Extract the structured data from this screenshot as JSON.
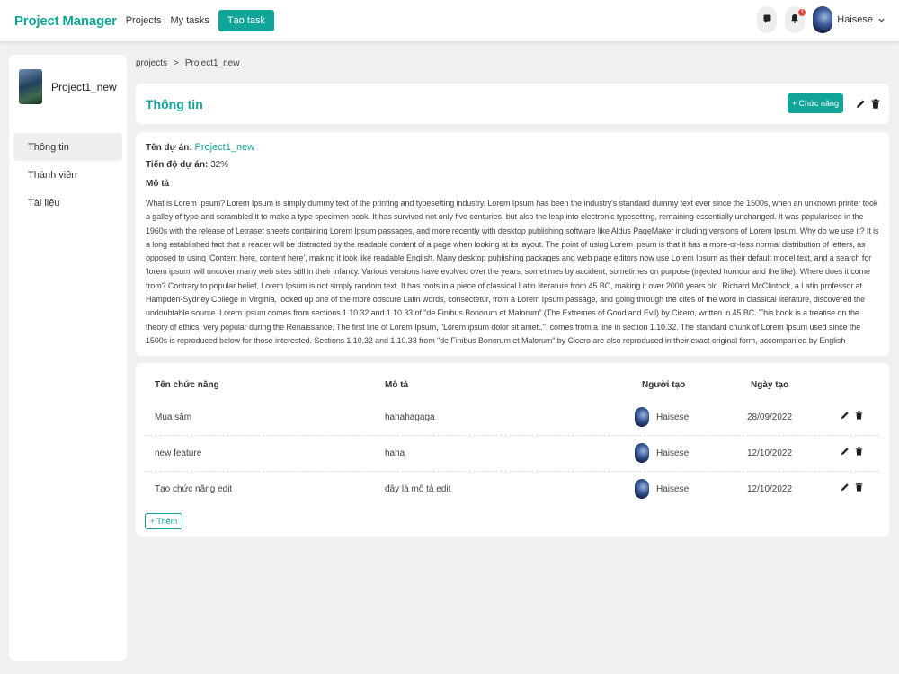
{
  "navbar": {
    "brand": "Project Manager",
    "links": [
      "Projects",
      "My tasks"
    ],
    "cta_label": "Tạo task",
    "notification_count": "1",
    "user_name": "Haisese"
  },
  "sidebar": {
    "project_name": "Project1_new",
    "items": [
      {
        "label": "Thông tin",
        "active": true
      },
      {
        "label": "Thành viên",
        "active": false
      },
      {
        "label": "Tài liệu",
        "active": false
      }
    ]
  },
  "breadcrumb": {
    "root": "projects",
    "sep": ">",
    "current": "Project1_new"
  },
  "header": {
    "title": "Thông tin",
    "add_label": "+ Chức năng"
  },
  "info": {
    "name_label": "Tên dự án:",
    "name_value": "Project1_new",
    "progress_label": "Tiến độ dự án:",
    "progress_value": "32%",
    "desc_label": "Mô tả",
    "desc_text": "What is Lorem Ipsum? Lorem Ipsum is simply dummy text of the printing and typesetting industry. Lorem Ipsum has been the industry's standard dummy text ever since the 1500s, when an unknown printer took a galley of type and scrambled it to make a type specimen book. It has survived not only five centuries, but also the leap into electronic typesetting, remaining essentially unchanged. It was popularised in the 1960s with the release of Letraset sheets containing Lorem Ipsum passages, and more recently with desktop publishing software like Aldus PageMaker including versions of Lorem Ipsum. Why do we use it? It is a long established fact that a reader will be distracted by the readable content of a page when looking at its layout. The point of using Lorem Ipsum is that it has a more-or-less normal distribution of letters, as opposed to using 'Content here, content here', making it look like readable English. Many desktop publishing packages and web page editors now use Lorem Ipsum as their default model text, and a search for 'lorem ipsum' will uncover many web sites still in their infancy. Various versions have evolved over the years, sometimes by accident, sometimes on purpose (injected humour and the like). Where does it come from? Contrary to popular belief, Lorem Ipsum is not simply random text. It has roots in a piece of classical Latin literature from 45 BC, making it over 2000 years old. Richard McClintock, a Latin professor at Hampden-Sydney College in Virginia, looked up one of the more obscure Latin words, consectetur, from a Lorem Ipsum passage, and going through the cites of the word in classical literature, discovered the undoubtable source. Lorem Ipsum comes from sections 1.10.32 and 1.10.33 of \"de Finibus Bonorum et Malorum\" (The Extremes of Good and Evil) by Cicero, written in 45 BC. This book is a treatise on the theory of ethics, very popular during the Renaissance. The first line of Lorem Ipsum, \"Lorem ipsum dolor sit amet..\", comes from a line in section 1.10.32. The standard chunk of Lorem Ipsum used since the 1500s is reproduced below for those interested. Sections 1.10.32 and 1.10.33 from \"de Finibus Bonorum et Malorum\" by Cicero are also reproduced in their exact original form, accompanied by English"
  },
  "table": {
    "headers": [
      "Tên chức năng",
      "Mô tả",
      "Người tạo",
      "Ngày tạo"
    ],
    "rows": [
      {
        "name": "Mua sắm",
        "desc": "hahahagaga",
        "creator": "Haisese",
        "date": "28/09/2022"
      },
      {
        "name": "new feature",
        "desc": "haha",
        "creator": "Haisese",
        "date": "12/10/2022"
      },
      {
        "name": "Tạo chức năng edit",
        "desc": "đây là mô tả edit",
        "creator": "Haisese",
        "date": "12/10/2022"
      }
    ],
    "add_label": "+ Thêm"
  },
  "colors": {
    "accent": "#11a59a",
    "background": "#f0f0f1",
    "badge": "#e74c3c"
  },
  "icons": [
    "chat-icon",
    "bell-icon",
    "chevron-down-icon",
    "pencil-icon",
    "trash-icon"
  ]
}
